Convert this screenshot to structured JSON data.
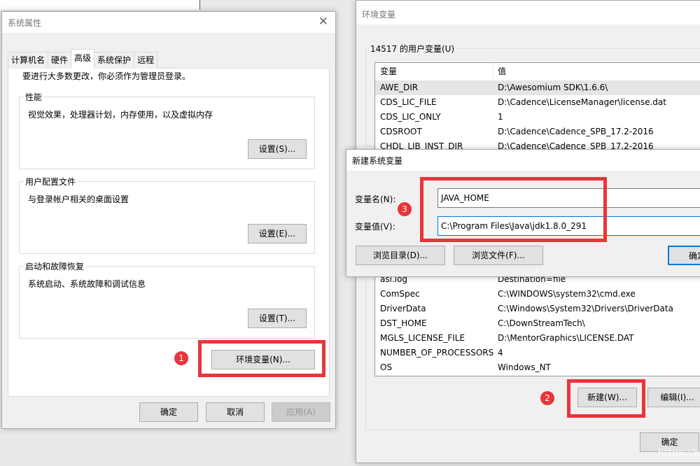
{
  "system_properties": {
    "title": "系统属性",
    "close_icon": "close-icon",
    "tabs": [
      {
        "label": "计算机名"
      },
      {
        "label": "硬件"
      },
      {
        "label": "高级"
      },
      {
        "label": "系统保护"
      },
      {
        "label": "远程"
      }
    ],
    "notice": "要进行大多数更改，你必须作为管理员登录。",
    "performance": {
      "label": "性能",
      "desc": "视觉效果，处理器计划，内存使用，以及虚拟内存",
      "button": "设置(S)..."
    },
    "user_profiles": {
      "label": "用户配置文件",
      "desc": "与登录帐户相关的桌面设置",
      "button": "设置(E)..."
    },
    "startup": {
      "label": "启动和故障恢复",
      "desc": "系统启动、系统故障和调试信息",
      "button": "设置(T)..."
    },
    "env_button": "环境变量(N)...",
    "ok": "确定",
    "cancel": "取消",
    "apply": "应用(A)"
  },
  "env_vars": {
    "title": "环境变量",
    "user_group_label": "14517 的用户变量(U)",
    "headers": {
      "name": "变量",
      "value": "值"
    },
    "user_rows": [
      {
        "name": "AWE_DIR",
        "value": "D:\\Awesomium SDK\\1.6.6\\"
      },
      {
        "name": "CDS_LIC_FILE",
        "value": "D:\\Cadence\\LicenseManager\\license.dat"
      },
      {
        "name": "CDS_LIC_ONLY",
        "value": "1"
      },
      {
        "name": "CDSROOT",
        "value": "D:\\Cadence\\Cadence_SPB_17.2-2016"
      },
      {
        "name": "CHDL_LIB_INST_DIR",
        "value": "D:\\Cadence\\Cadence_SPB_17.2-2016"
      }
    ],
    "system_rows": [
      {
        "name": "asl.log",
        "value": "Destination=file"
      },
      {
        "name": "ComSpec",
        "value": "C:\\WINDOWS\\system32\\cmd.exe"
      },
      {
        "name": "DriverData",
        "value": "C:\\Windows\\System32\\Drivers\\DriverData"
      },
      {
        "name": "DST_HOME",
        "value": "C:\\DownStreamTech\\"
      },
      {
        "name": "MGLS_LICENSE_FILE",
        "value": "D:\\MentorGraphics\\LICENSE.DAT"
      },
      {
        "name": "NUMBER_OF_PROCESSORS",
        "value": "4"
      },
      {
        "name": "OS",
        "value": "Windows_NT"
      }
    ],
    "new_button": "新建(W)...",
    "edit_button": "编辑(I)...",
    "ok": "确定"
  },
  "new_var_dialog": {
    "title": "新建系统变量",
    "name_label": "变量名(N):",
    "name_value": "JAVA_HOME",
    "value_label": "变量值(V):",
    "value_value": "C:\\Program Files\\Java\\jdk1.8.0_291",
    "browse_dir": "浏览目录(D)...",
    "browse_file": "浏览文件(F)...",
    "ok": "确定"
  },
  "annotations": {
    "step1": "1",
    "step2": "2",
    "step3": "3",
    "color": "#e8343b"
  },
  "watermark": "https://bl"
}
